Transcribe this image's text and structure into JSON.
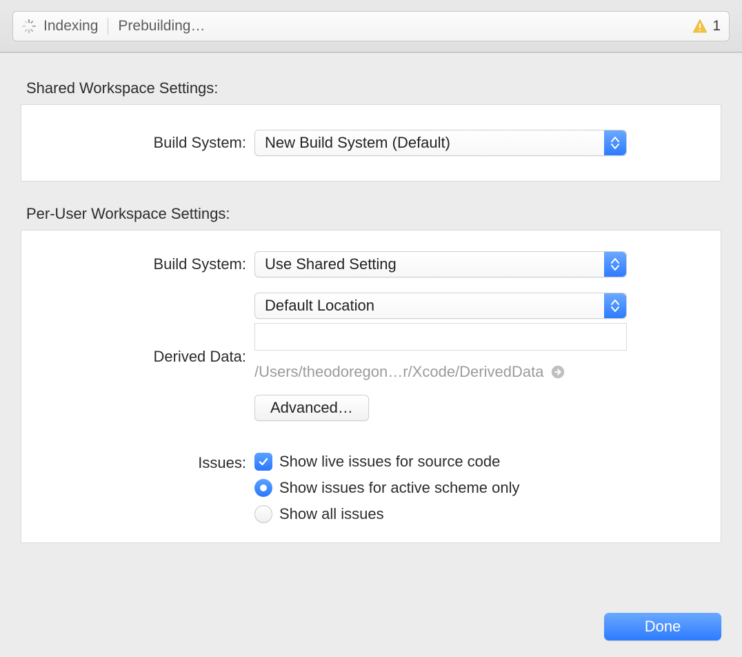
{
  "status": {
    "indexing_label": "Indexing",
    "task_label": "Prebuilding…",
    "warning_count": "1"
  },
  "shared": {
    "title": "Shared Workspace Settings:",
    "build_system_label": "Build System:",
    "build_system_value": "New Build System (Default)"
  },
  "peruser": {
    "title": "Per-User Workspace Settings:",
    "build_system_label": "Build System:",
    "build_system_value": "Use Shared Setting",
    "derived_data_label": "Derived Data:",
    "derived_data_value": "Default Location",
    "derived_data_field": "",
    "derived_data_path": "/Users/theodoregon…r/Xcode/DerivedData",
    "advanced_label": "Advanced…",
    "issues_label": "Issues:",
    "issues": {
      "live": "Show live issues for source code",
      "active_only": "Show issues for active scheme only",
      "all": "Show all issues"
    }
  },
  "footer": {
    "done_label": "Done"
  }
}
